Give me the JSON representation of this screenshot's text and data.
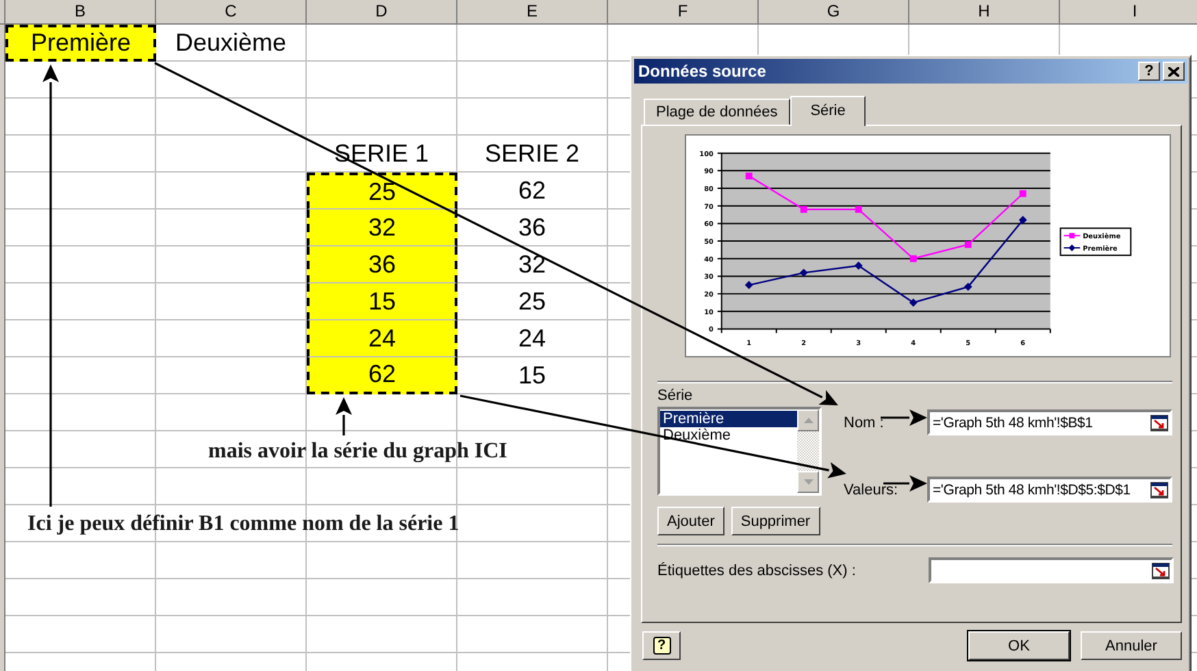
{
  "sheet": {
    "columns": [
      "B",
      "C",
      "D",
      "E",
      "F",
      "G",
      "H",
      "I"
    ],
    "rows": [
      {
        "B": {
          "text": "Première",
          "highlighted": true
        },
        "C": {
          "text": "Deuxième",
          "highlighted": false
        }
      },
      {},
      {},
      {
        "D": {
          "text": "SERIE 1",
          "highlighted": false
        },
        "E": {
          "text": "SERIE 2",
          "highlighted": false
        }
      },
      {
        "D": {
          "text": "25",
          "highlighted": true
        },
        "E": {
          "text": "62",
          "highlighted": false
        }
      },
      {
        "D": {
          "text": "32",
          "highlighted": true
        },
        "E": {
          "text": "36",
          "highlighted": false
        }
      },
      {
        "D": {
          "text": "36",
          "highlighted": true
        },
        "E": {
          "text": "32",
          "highlighted": false
        }
      },
      {
        "D": {
          "text": "15",
          "highlighted": true
        },
        "E": {
          "text": "25",
          "highlighted": false
        }
      },
      {
        "D": {
          "text": "24",
          "highlighted": true
        },
        "E": {
          "text": "24",
          "highlighted": false
        }
      },
      {
        "D": {
          "text": "62",
          "highlighted": true
        },
        "E": {
          "text": "15",
          "highlighted": false
        }
      }
    ]
  },
  "annotations": [
    {
      "text": "mais avoir la série du graph ICI"
    },
    {
      "text": "Ici je peux définir B1 comme nom de la série 1"
    }
  ],
  "dialog": {
    "title": "Données source",
    "title_buttons": [
      {
        "kind": "help",
        "label": "?"
      },
      {
        "kind": "close"
      }
    ],
    "tabs": [
      {
        "label": "Plage de données",
        "selected": false
      },
      {
        "label": "Série",
        "selected": true
      }
    ],
    "chart_data": {
      "type": "line",
      "categories": [
        "1",
        "2",
        "3",
        "4",
        "5",
        "6"
      ],
      "ylim": [
        0,
        100
      ],
      "yticks": [
        0,
        10,
        20,
        30,
        40,
        50,
        60,
        70,
        80,
        90,
        100
      ],
      "grid": true,
      "legend": true,
      "series": [
        {
          "name": "Deuxième",
          "color": "#ff00ff",
          "marker": "square",
          "values": [
            87,
            68,
            68,
            40,
            48,
            77
          ]
        },
        {
          "name": "Première",
          "color": "#000080",
          "marker": "diamond",
          "values": [
            25,
            32,
            36,
            15,
            24,
            62
          ]
        }
      ]
    },
    "series_label": "Série",
    "series_list": [
      {
        "label": "Première",
        "selected": true
      },
      {
        "label": "Deuxième",
        "selected": false
      }
    ],
    "fields": [
      {
        "label": "Nom :",
        "value": "='Graph 5th 48 kmh'!$B$1"
      },
      {
        "label": "Valeurs:",
        "value": "='Graph 5th 48 kmh'!$D$5:$D$1"
      }
    ],
    "series_buttons": [
      "Ajouter",
      "Supprimer"
    ],
    "axis_labels_field": {
      "label": "Étiquettes des abscisses (X) :"
    },
    "help_button": {
      "label": "?"
    },
    "buttons": [
      {
        "label": "OK",
        "default": true
      },
      {
        "label": "Annuler",
        "default": false
      }
    ]
  }
}
